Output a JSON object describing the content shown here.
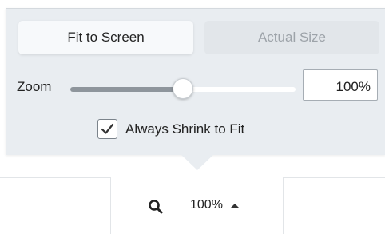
{
  "popover": {
    "fit_to_screen_label": "Fit to Screen",
    "actual_size_label": "Actual Size",
    "zoom_label": "Zoom",
    "zoom_slider_level": 0.5,
    "zoom_input_value": "100%",
    "always_shrink_label": "Always Shrink to Fit",
    "always_shrink_checked": true
  },
  "zoom_bar": {
    "value": "100%",
    "icons": {
      "search": "search-icon",
      "caret": "caret-up-icon"
    }
  },
  "colors": {
    "panel_bg": "#e9edf1",
    "slider_fill": "#8e959c",
    "disabled_text": "#9da3a9"
  }
}
